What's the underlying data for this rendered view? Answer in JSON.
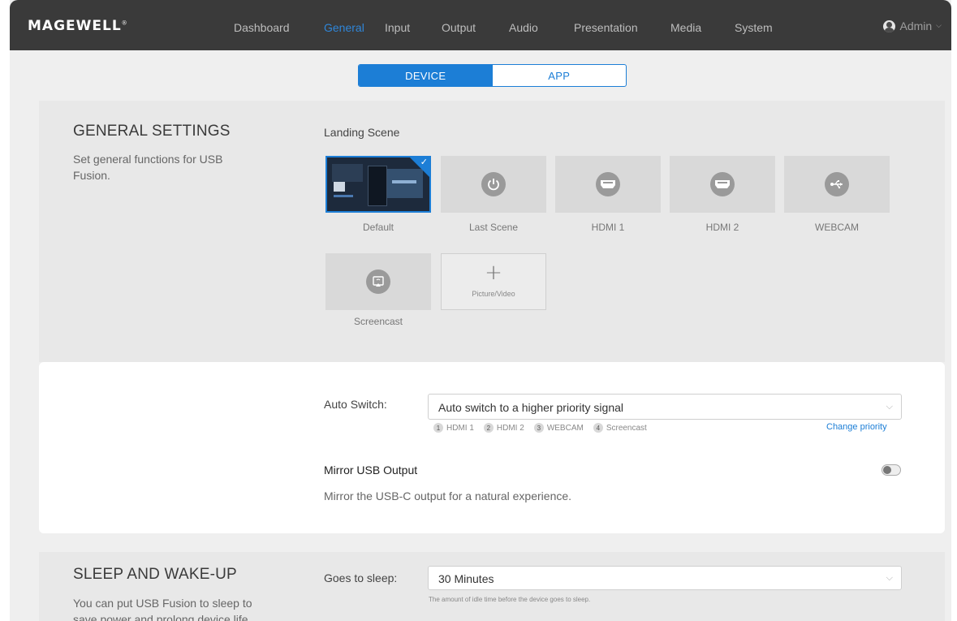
{
  "brand": {
    "logo": "MAGEWELL",
    "logo_mark": "®"
  },
  "nav": {
    "items": [
      "Dashboard",
      "General",
      "Input",
      "Output",
      "Audio",
      "Presentation",
      "Media",
      "System"
    ],
    "active": "General",
    "user": "Admin"
  },
  "tabs": {
    "device": "DEVICE",
    "app": "APP",
    "active": "DEVICE"
  },
  "general": {
    "title": "GENERAL SETTINGS",
    "description_line1": "Set general functions for USB",
    "description_line2": "Fusion.",
    "landing_scene_label": "Landing Scene",
    "scenes": [
      {
        "label": "Default",
        "icon": "thumbnail-image",
        "selected": true
      },
      {
        "label": "Last Scene",
        "icon": "power-icon"
      },
      {
        "label": "HDMI 1",
        "icon": "hdmi-icon"
      },
      {
        "label": "HDMI 2",
        "icon": "hdmi-icon"
      },
      {
        "label": "WEBCAM",
        "icon": "usb-icon"
      },
      {
        "label": "Screencast",
        "icon": "screencast-icon"
      }
    ],
    "add_scene_label": "Picture/Video"
  },
  "auto_switch": {
    "label": "Auto Switch:",
    "value": "Auto switch to a higher priority signal",
    "priorities": [
      {
        "num": "1",
        "label": "HDMI 1"
      },
      {
        "num": "2",
        "label": "HDMI 2"
      },
      {
        "num": "3",
        "label": "WEBCAM"
      },
      {
        "num": "4",
        "label": "Screencast"
      }
    ],
    "change_priority": "Change priority"
  },
  "mirror": {
    "title": "Mirror USB Output",
    "description": "Mirror the USB-C output for a natural experience.",
    "enabled": false
  },
  "sleep": {
    "title": "SLEEP AND WAKE-UP",
    "description_line1": "You can put USB Fusion to sleep to",
    "description_line2": "save power and prolong device life.",
    "goes_to_sleep_label": "Goes to sleep:",
    "value": "30 Minutes",
    "hint": "The amount of idle time before the device goes to sleep."
  },
  "colors": {
    "accent": "#1c7ed6",
    "nav_bg": "#3a3a3a"
  }
}
